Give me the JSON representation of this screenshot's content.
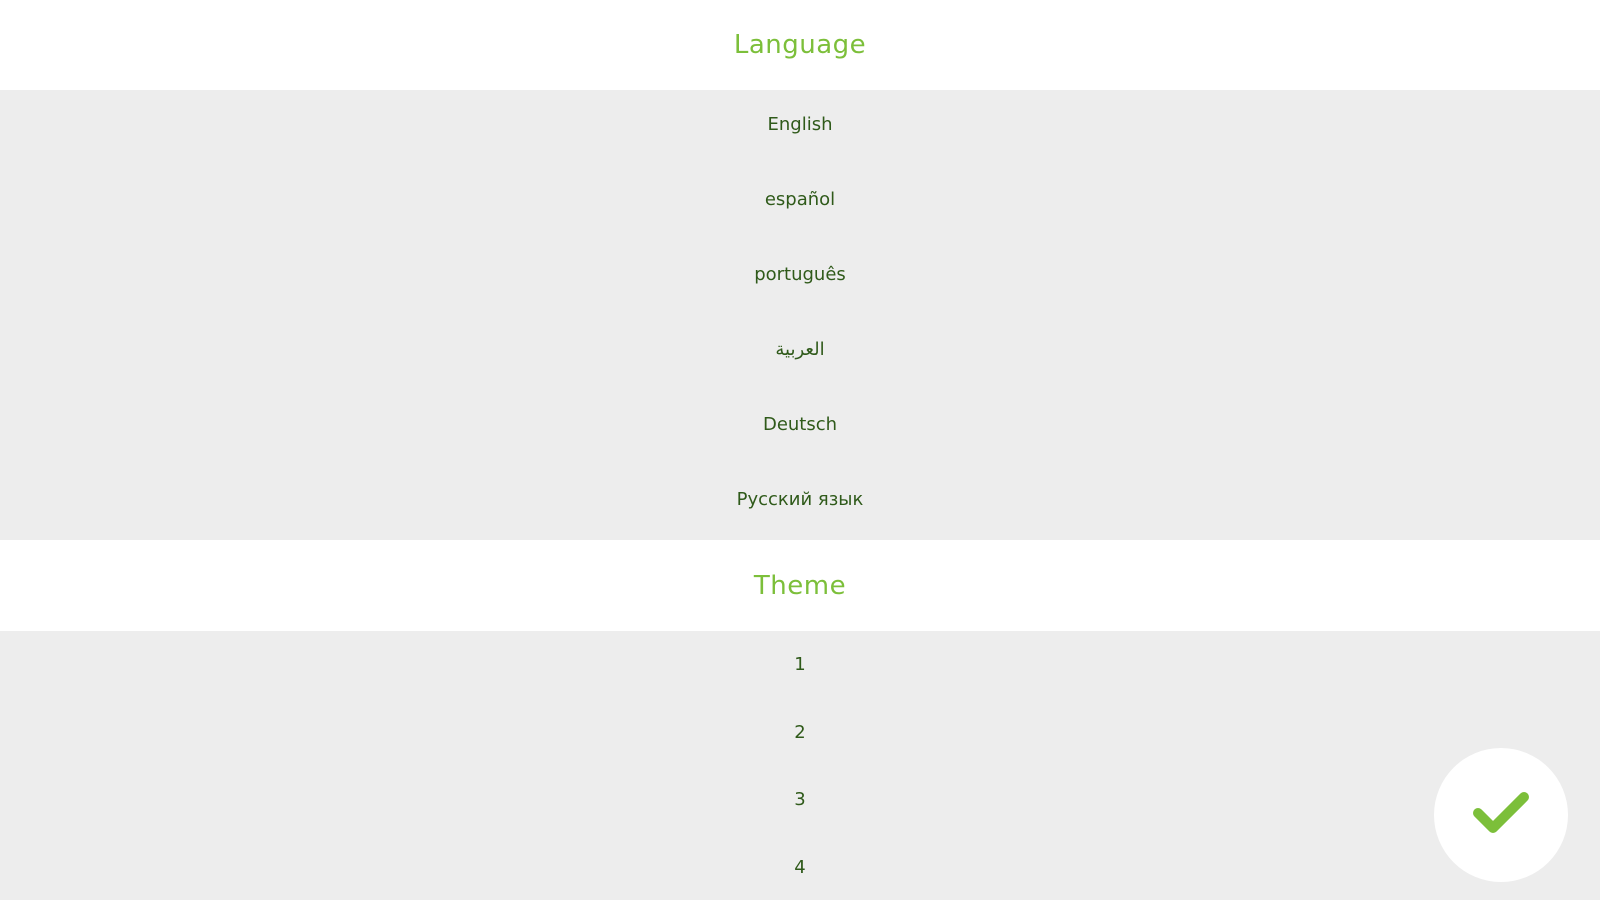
{
  "language_section": {
    "title": "Language",
    "items": [
      "English",
      "español",
      "português",
      "العربية",
      "Deutsch",
      "Русский язык"
    ]
  },
  "theme_section": {
    "title": "Theme",
    "items": [
      "1",
      "2",
      "3",
      "4"
    ]
  },
  "confirm": {
    "icon": "checkmark-icon",
    "color": "#7cbf3a"
  },
  "colors": {
    "accent": "#7cbf3a",
    "item_text": "#2f5a1a",
    "list_background": "#ededed",
    "header_background": "#ffffff"
  }
}
